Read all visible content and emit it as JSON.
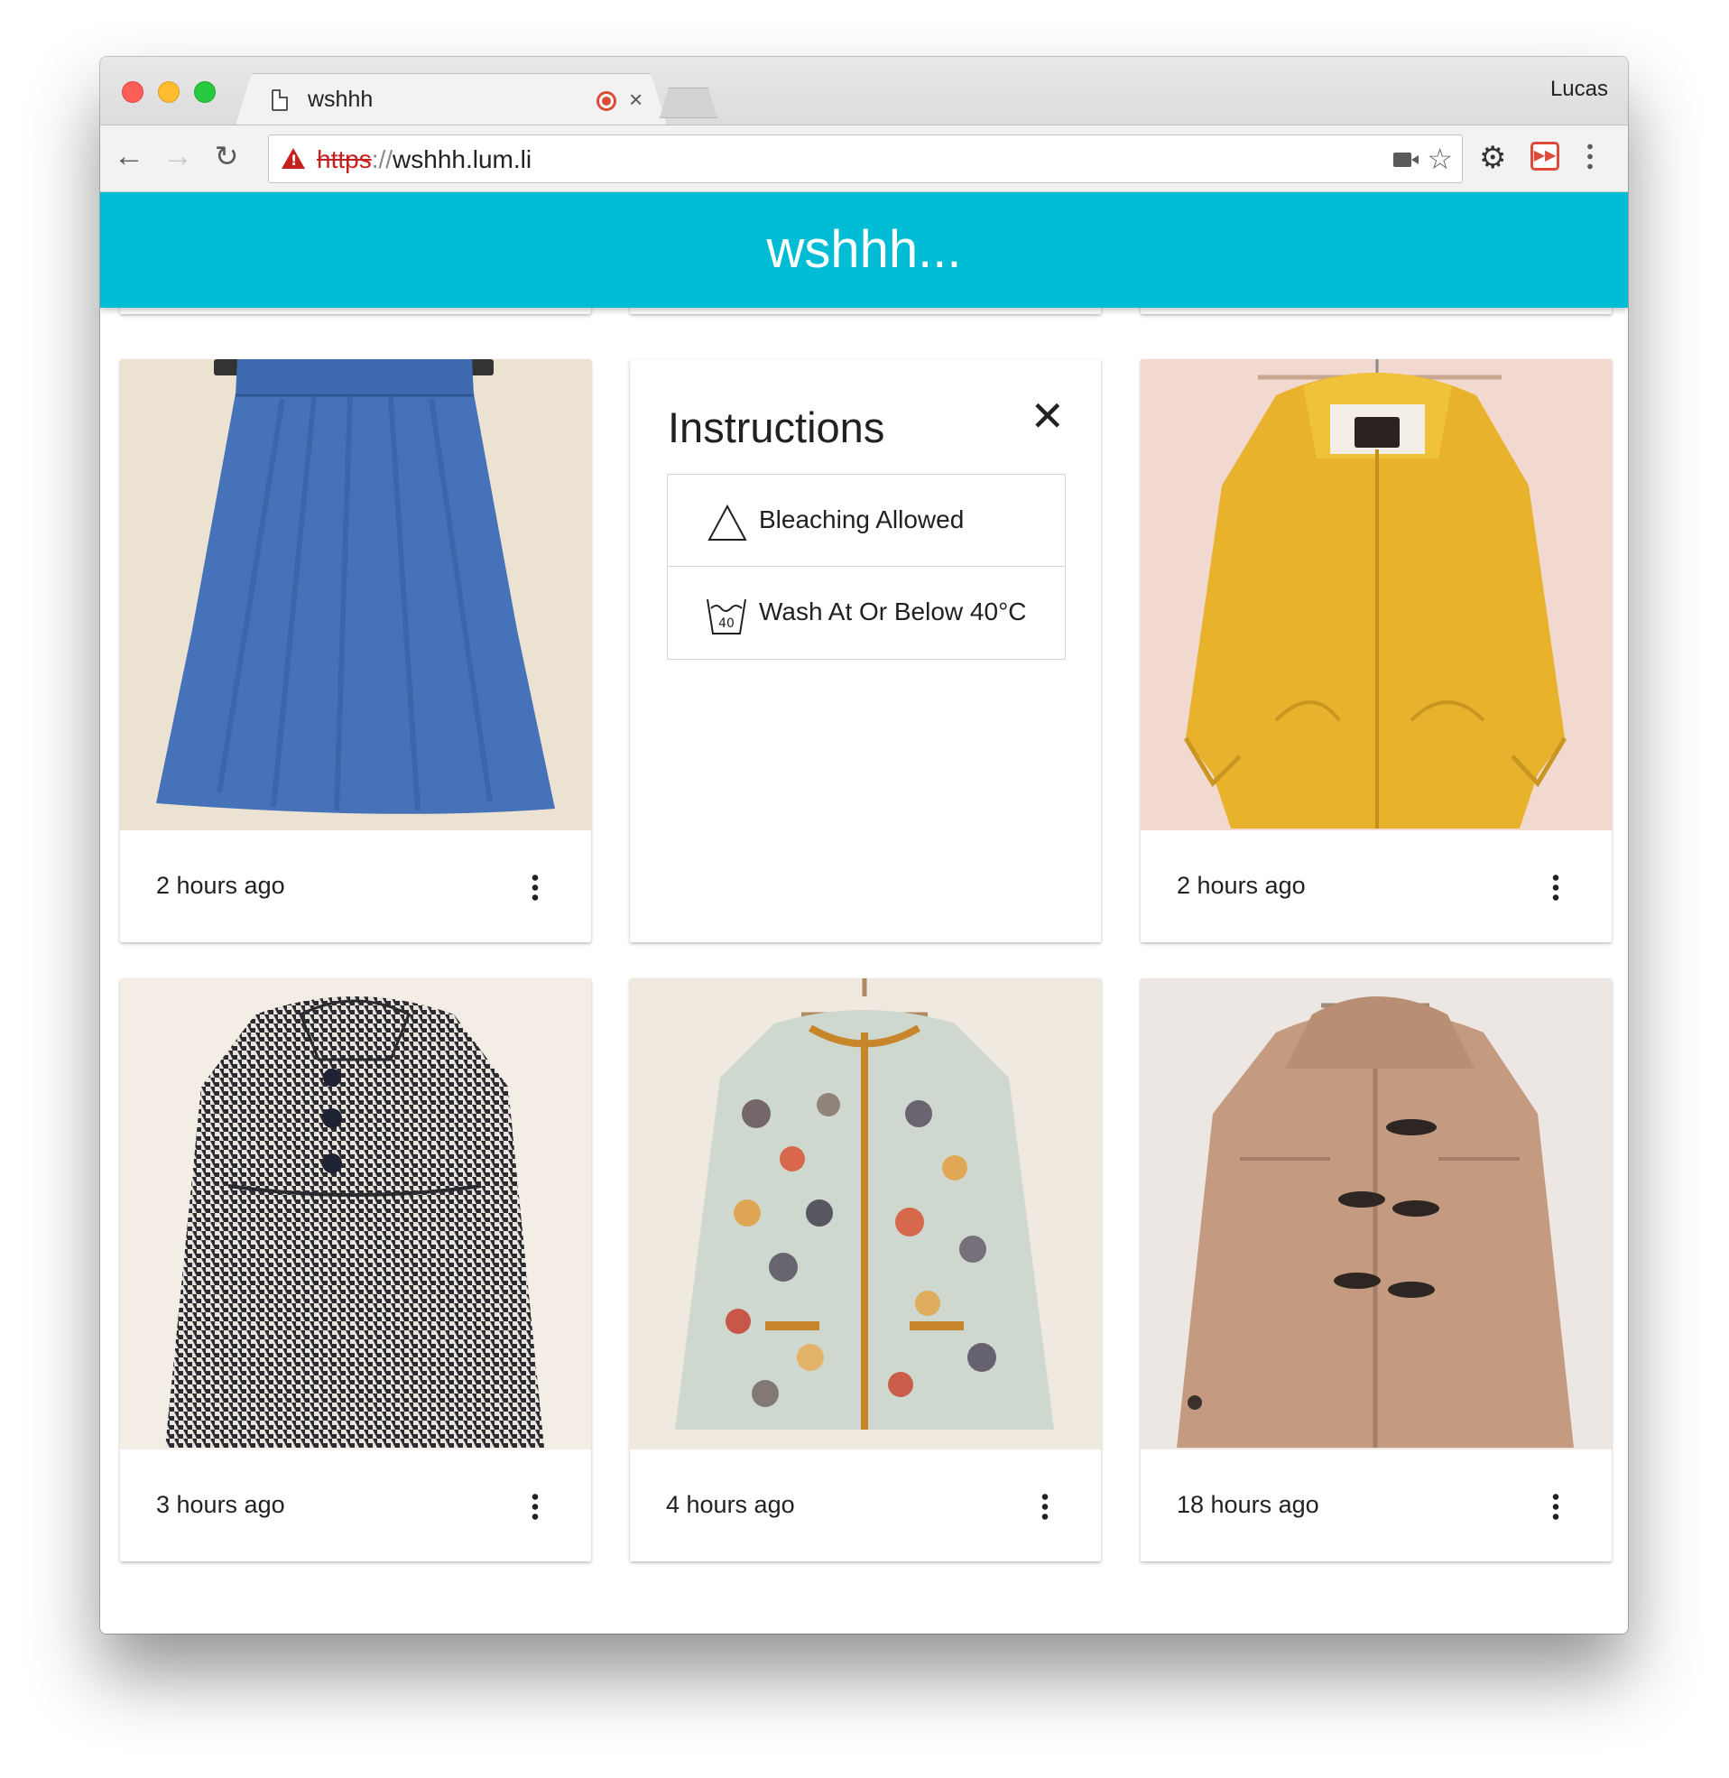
{
  "browser": {
    "tab_title": "wshhh",
    "profile_name": "Lucas",
    "url_scheme": "https",
    "url_separator": "://",
    "url_host": "wshhh.lum.li"
  },
  "app": {
    "title": "wshhh..."
  },
  "instructions": {
    "title": "Instructions",
    "items": [
      {
        "label": "Bleaching Allowed",
        "icon": "bleaching-allowed-icon"
      },
      {
        "label": "Wash At Or Below 40°C",
        "icon": "wash-40-icon",
        "icon_text": "40"
      }
    ]
  },
  "cards": [
    {
      "item": "blue-skirt",
      "timestamp": "2 hours ago"
    },
    {
      "item": "yellow-hooded-jacket",
      "timestamp": "2 hours ago"
    },
    {
      "item": "houndstooth-coat",
      "timestamp": "3 hours ago"
    },
    {
      "item": "patterned-jacket",
      "timestamp": "4 hours ago"
    },
    {
      "item": "camel-duffle-coat",
      "timestamp": "18 hours ago"
    }
  ],
  "icons": {
    "back": "←",
    "forward": "→",
    "reload": "↻",
    "star": "☆",
    "gear": "⚙",
    "close": "×",
    "instructions_close": "✕"
  },
  "colors": {
    "app_bar": "#00bcd4",
    "warning": "#c5221f"
  }
}
